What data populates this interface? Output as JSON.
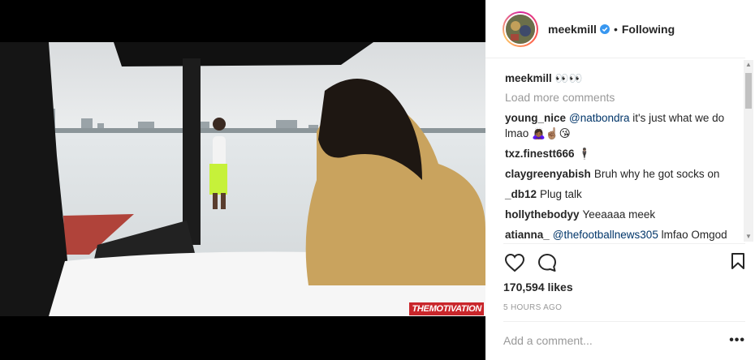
{
  "post": {
    "watermark": "THEMOTIVATION"
  },
  "header": {
    "username": "meekmill",
    "separator": "•",
    "follow_label": "Following"
  },
  "caption": {
    "username": "meekmill",
    "text": "👀👀"
  },
  "load_more": "Load more comments",
  "comments": [
    {
      "username": "young_nice",
      "mention": "@natbondra",
      "text": " it's just what we do lmao 🙇🏾‍♀️☝🏽😘"
    },
    {
      "username": "txz.finestt666",
      "mention": "",
      "text": "🕴🏽"
    },
    {
      "username": "claygreenyabish",
      "mention": "",
      "text": "Bruh why he got socks on"
    },
    {
      "username": "_db12",
      "mention": "",
      "text": "Plug talk"
    },
    {
      "username": "hollythebodyy",
      "mention": "",
      "text": "Yeeaaaa meek"
    },
    {
      "username": "atianna_",
      "mention": "@thefootballnews305",
      "text": " lmfao Omgod 😂"
    }
  ],
  "actions": {
    "likes": "170,594 likes",
    "timestamp": "5 HOURS AGO"
  },
  "add_comment": {
    "placeholder": "Add a comment...",
    "more": "•••"
  },
  "colors": {
    "accent": "#3897f0",
    "mention": "#003569",
    "muted": "#999999",
    "watermark_bg": "#c9262b"
  }
}
